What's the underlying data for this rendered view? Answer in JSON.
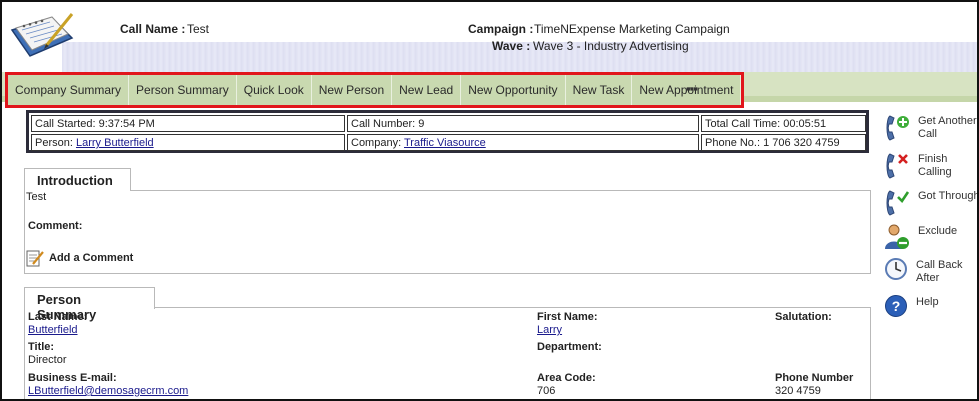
{
  "header": {
    "call_name_label": "Call Name :",
    "call_name_value": "Test",
    "campaign_label": "Campaign :",
    "campaign_value": "TimeNExpense Marketing Campaign",
    "wave_label": "Wave :",
    "wave_value": "Wave 3 - Industry Advertising"
  },
  "tabs": [
    {
      "label": "Company Summary"
    },
    {
      "label": "Person Summary"
    },
    {
      "label": "Quick Look"
    },
    {
      "label": "New Person"
    },
    {
      "label": "New Lead"
    },
    {
      "label": "New Opportunity"
    },
    {
      "label": "New Task"
    },
    {
      "label": "New Appointment"
    }
  ],
  "more_label": "▪▪▪",
  "call_info": {
    "call_started": "Call Started: 9:37:54 PM",
    "call_number": "Call Number: 9",
    "total_call_time": "Total Call Time: 00:05:51",
    "person_label": "Person:",
    "person_value": "Larry Butterfield",
    "company_label": "Company:",
    "company_value": "Traffic Viasource",
    "phone": "Phone No.: 1 706 320 4759"
  },
  "introduction": {
    "tab_label": "Introduction",
    "text": "Test",
    "comment_label": "Comment:",
    "add_comment_label": "Add a Comment"
  },
  "person_summary": {
    "tab_label": "Person Summary",
    "last_name_label": "Last Name:",
    "last_name_value": "Butterfield",
    "first_name_label": "First Name:",
    "first_name_value": "Larry",
    "salutation_label": "Salutation:",
    "title_label": "Title:",
    "title_value": "Director",
    "department_label": "Department:",
    "email_label": "Business E-mail:",
    "email_value": "LButterfield@demosagecrm.com",
    "area_code_label": "Area Code:",
    "area_code_value": "706",
    "phone_number_label": "Phone Number",
    "phone_number_value": "320 4759"
  },
  "actions": [
    {
      "label": "Get Another Call",
      "icon": "phone-add-icon"
    },
    {
      "label": "Finish Calling",
      "icon": "phone-stop-icon"
    },
    {
      "label": "Got Through",
      "icon": "phone-check-icon"
    },
    {
      "label": "Exclude",
      "icon": "person-exclude-icon"
    },
    {
      "label": "Call Back After",
      "icon": "clock-icon"
    },
    {
      "label": "Help",
      "icon": "help-icon"
    }
  ],
  "colors": {
    "tab_highlight_border": "#e1161c",
    "tab_bg": "#c9d9b0",
    "header_band": "#dfe0f2",
    "link": "#1a1a8c"
  }
}
